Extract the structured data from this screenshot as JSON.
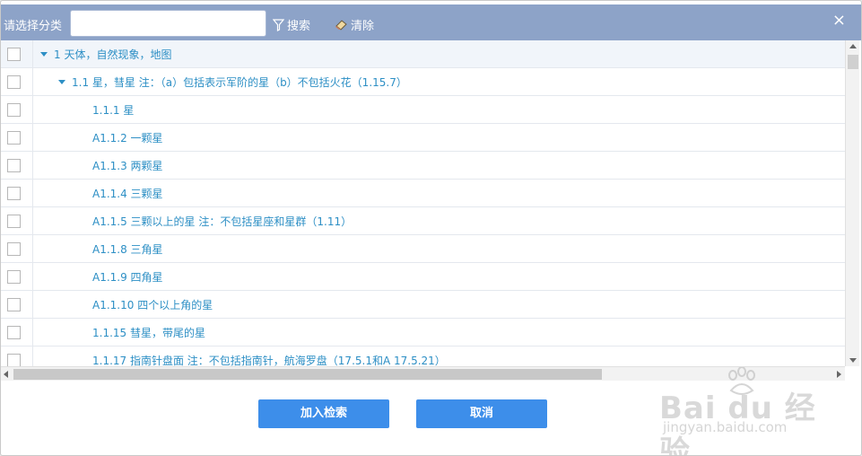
{
  "toolbar": {
    "label": "请选择分类",
    "search_value": "",
    "search_button": "搜索",
    "clear_button": "清除",
    "close_glyph": "×",
    "background": "#8da3c8"
  },
  "tree": {
    "rows": [
      {
        "text": "1 天体，自然现象，地图",
        "expandable": true
      },
      {
        "text": "1.1 星，彗星 注：（a）包括表示军阶的星（b）不包括火花（1.15.7）",
        "expandable": true
      },
      {
        "text": "1.1.1 星",
        "expandable": false
      },
      {
        "text": "A1.1.2 一颗星",
        "expandable": false
      },
      {
        "text": "A1.1.3 两颗星",
        "expandable": false
      },
      {
        "text": "A1.1.4 三颗星",
        "expandable": false
      },
      {
        "text": "A1.1.5 三颗以上的星 注：不包括星座和星群（1.11）",
        "expandable": false
      },
      {
        "text": "A1.1.8 三角星",
        "expandable": false
      },
      {
        "text": "A1.1.9 四角星",
        "expandable": false
      },
      {
        "text": "A1.1.10 四个以上角的星",
        "expandable": false
      },
      {
        "text": "1.1.15 彗星，带尾的星",
        "expandable": false
      },
      {
        "text": "1.1.17 指南针盘面 注：不包括指南针，航海罗盘（17.5.1和A 17.5.21）",
        "expandable": false
      }
    ],
    "text_color": "#2d8fc5"
  },
  "actions": {
    "add_label": "加入检索",
    "cancel_label": "取消",
    "button_color": "#3d8eea"
  },
  "watermark": {
    "logo": "Bai du 经验",
    "url": "jingyan.baidu.com"
  }
}
